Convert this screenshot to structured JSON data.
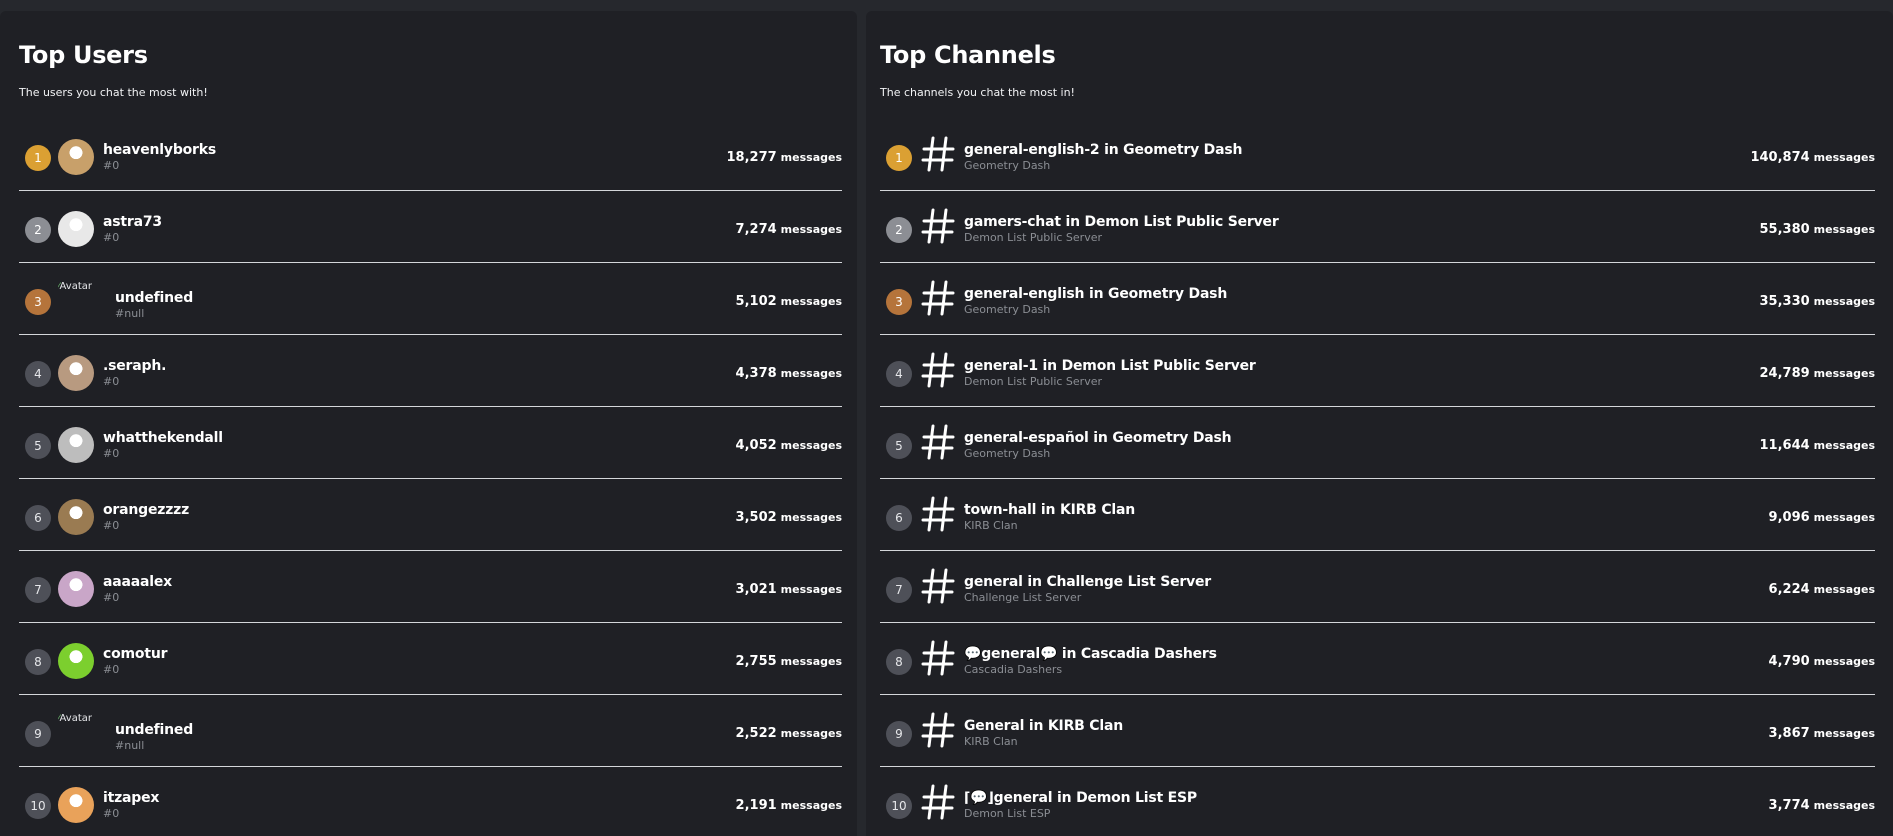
{
  "top_users": {
    "title": "Top Users",
    "subtitle": "The users you chat the most with!",
    "unit": "messages",
    "items": [
      {
        "rank": "1",
        "name": "heavenlyborks",
        "tag": "#0",
        "count": "18,277",
        "avatar_color": "#c8a06a"
      },
      {
        "rank": "2",
        "name": "astra73",
        "tag": "#0",
        "count": "7,274",
        "avatar_color": "#e8e8e8"
      },
      {
        "rank": "3",
        "name": "undefined",
        "tag": "#null",
        "count": "5,102",
        "avatar_alt": "Avatar"
      },
      {
        "rank": "4",
        "name": ".seraph.",
        "tag": "#0",
        "count": "4,378",
        "avatar_color": "#b89a80"
      },
      {
        "rank": "5",
        "name": "whatthekendall",
        "tag": "#0",
        "count": "4,052",
        "avatar_color": "#bdbdbd"
      },
      {
        "rank": "6",
        "name": "orangezzzz",
        "tag": "#0",
        "count": "3,502",
        "avatar_color": "#9a7b52"
      },
      {
        "rank": "7",
        "name": "aaaaalex",
        "tag": "#0",
        "count": "3,021",
        "avatar_color": "#c9a6c8"
      },
      {
        "rank": "8",
        "name": "comotur",
        "tag": "#0",
        "count": "2,755",
        "avatar_color": "#7ccf2e"
      },
      {
        "rank": "9",
        "name": "undefined",
        "tag": "#null",
        "count": "2,522",
        "avatar_alt": "Avatar"
      },
      {
        "rank": "10",
        "name": "itzapex",
        "tag": "#0",
        "count": "2,191",
        "avatar_color": "#e9a25a"
      }
    ]
  },
  "top_channels": {
    "title": "Top Channels",
    "subtitle": "The channels you chat the most in!",
    "unit": "messages",
    "items": [
      {
        "rank": "1",
        "name": "general-english-2 in Geometry Dash",
        "server": "Geometry Dash",
        "count": "140,874"
      },
      {
        "rank": "2",
        "name": "gamers-chat in Demon List Public Server",
        "server": "Demon List Public Server",
        "count": "55,380"
      },
      {
        "rank": "3",
        "name": "general-english in Geometry Dash",
        "server": "Geometry Dash",
        "count": "35,330"
      },
      {
        "rank": "4",
        "name": "general-1 in Demon List Public Server",
        "server": "Demon List Public Server",
        "count": "24,789"
      },
      {
        "rank": "5",
        "name": "general-español in Geometry Dash",
        "server": "Geometry Dash",
        "count": "11,644"
      },
      {
        "rank": "6",
        "name": "town-hall in KIRB Clan",
        "server": "KIRB Clan",
        "count": "9,096"
      },
      {
        "rank": "7",
        "name": "general in Challenge List Server",
        "server": "Challenge List Server",
        "count": "6,224"
      },
      {
        "rank": "8",
        "name": "💬general💬 in Cascadia Dashers",
        "server": "Cascadia Dashers",
        "count": "4,790"
      },
      {
        "rank": "9",
        "name": "General in KIRB Clan",
        "server": "KIRB Clan",
        "count": "3,867"
      },
      {
        "rank": "10",
        "name": "⌈💬⌋general in Demon List ESP",
        "server": "Demon List ESP",
        "count": "3,774"
      }
    ]
  },
  "colors": {
    "gold": "#dba033",
    "silver": "#8c8e94",
    "bronze": "#b5743b",
    "panel_bg": "#1f2025",
    "page_bg": "#26282d"
  },
  "icons": {
    "channel": "hash-icon",
    "avatar_broken": "broken-image-icon"
  }
}
